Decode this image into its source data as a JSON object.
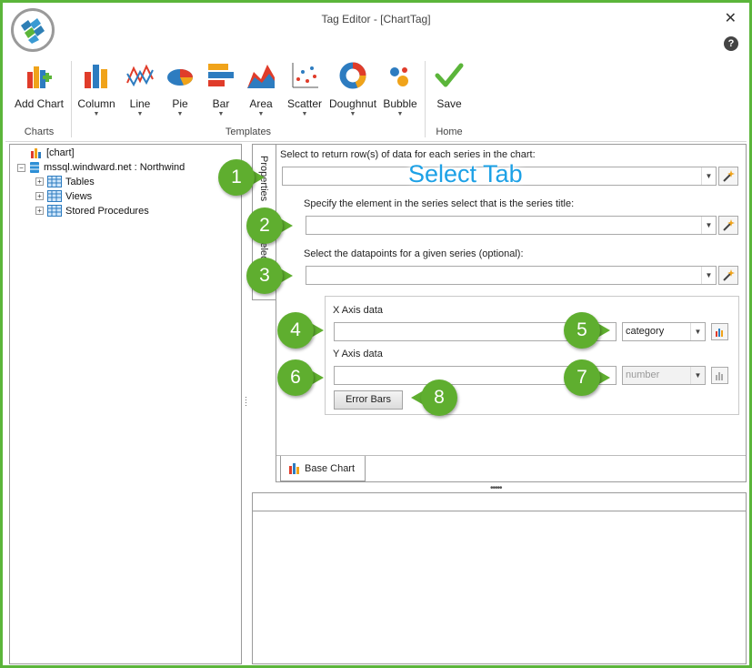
{
  "window": {
    "title": "Tag Editor - [ChartTag]",
    "close_glyph": "✕",
    "help_glyph": "?"
  },
  "ribbon": {
    "groups": {
      "charts": "Charts",
      "templates": "Templates",
      "home": "Home"
    },
    "buttons": {
      "add_chart": "Add Chart",
      "column": "Column",
      "line": "Line",
      "pie": "Pie",
      "bar": "Bar",
      "area": "Area",
      "scatter": "Scatter",
      "doughnut": "Doughnut",
      "bubble": "Bubble",
      "save": "Save"
    },
    "dropdown_arrow": "▼"
  },
  "tree": {
    "root": "[chart]",
    "datasource": "mssql.windward.net : Northwind",
    "children": [
      "Tables",
      "Views",
      "Stored Procedures"
    ],
    "expand_glyph": "+",
    "collapse_glyph": "−"
  },
  "side_tabs": {
    "properties": "Properties",
    "select": "Select"
  },
  "form": {
    "series_rows_label": "Select to return row(s) of data for each series in the chart:",
    "series_title_label": "Specify the element in the series select that is the series title:",
    "datapoints_label": "Select the datapoints for a given series (optional):",
    "x_axis_label": "X Axis data",
    "x_axis_type": "category",
    "y_axis_label": "Y Axis data",
    "y_axis_type": "number",
    "error_bars_label": "Error Bars"
  },
  "bottom_tab": "Base Chart",
  "annotations": {
    "select_tab_text": "Select Tab",
    "callouts": [
      "1",
      "2",
      "3",
      "4",
      "5",
      "6",
      "7",
      "8"
    ]
  },
  "colors": {
    "window_border": "#5bb53a",
    "callout": "#5fae2f",
    "select_tab_text": "#1da1e6"
  }
}
